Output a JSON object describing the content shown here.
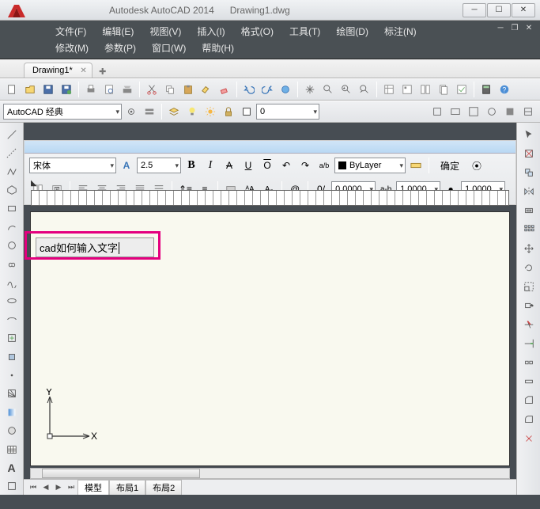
{
  "app": {
    "name": "Autodesk AutoCAD 2014",
    "doc": "Drawing1.dwg"
  },
  "menus": {
    "row1": [
      "文件(F)",
      "编辑(E)",
      "视图(V)",
      "插入(I)",
      "格式(O)",
      "工具(T)",
      "绘图(D)",
      "标注(N)"
    ],
    "row2": [
      "修改(M)",
      "参数(P)",
      "窗口(W)",
      "帮助(H)"
    ]
  },
  "tab": {
    "label": "Drawing1*"
  },
  "workspace": {
    "current": "AutoCAD 经典"
  },
  "layer": {
    "current": "0"
  },
  "text_fmt": {
    "font": "宋体",
    "height": "2.5",
    "color_label": "ByLayer",
    "ok": "确定",
    "tracking": "1.0000",
    "width_factor": "1.0000",
    "oblique": "0.0000",
    "spacing": "0"
  },
  "text_input": "cad如何输入文字",
  "ucs": {
    "x": "X",
    "y": "Y"
  },
  "model_tabs": {
    "items": [
      "模型",
      "布局1",
      "布局2"
    ],
    "active": 0
  },
  "icons": {
    "std": [
      "new",
      "open",
      "save",
      "saveas",
      "print",
      "print-preview",
      "publish",
      "undo",
      "redo",
      "cut",
      "copy",
      "paste",
      "match",
      "eraser",
      "undo2",
      "redo2",
      "link",
      "pan",
      "zoom-realtime",
      "zoom-window",
      "zoom-prev",
      "properties",
      "design-center",
      "tool-palettes",
      "sheet-set",
      "markup",
      "calc",
      "help"
    ],
    "ws": [
      "gear",
      "bulb",
      "sun",
      "lock",
      "color"
    ],
    "right_row1": [
      "a",
      "b",
      "c",
      "d",
      "e",
      "f"
    ],
    "left": [
      "line",
      "xline",
      "pline",
      "polygon",
      "rect",
      "arc",
      "circle",
      "revcloud",
      "spline",
      "ellipse",
      "ellipse-arc",
      "insert",
      "block",
      "point",
      "hatch",
      "gradient",
      "region",
      "table",
      "text",
      "add"
    ],
    "right": [
      "cursor",
      "box",
      "distance",
      "move",
      "rotate",
      "trim",
      "extend",
      "mirror",
      "fillet",
      "chamfer",
      "array",
      "offset",
      "scale",
      "stretch",
      "copy2",
      "explode",
      "join"
    ]
  }
}
